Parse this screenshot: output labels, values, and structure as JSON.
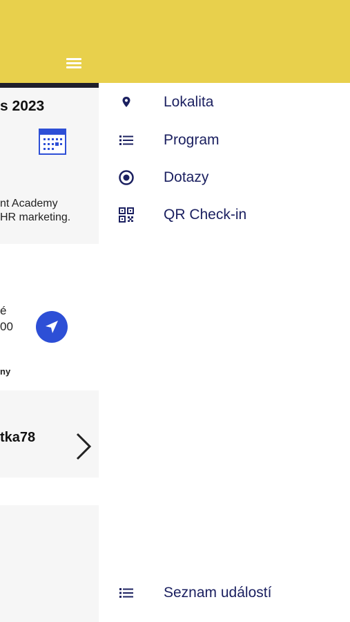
{
  "colors": {
    "accent_yellow": "#e8d04c",
    "menu_text": "#1b2060",
    "nav_blue": "#2d4fd6"
  },
  "underlay": {
    "title": "s 2023",
    "desc_line1": "nt Academy",
    "desc_line2": "HR marketing.",
    "time_line1": "é",
    "time_line2": "00",
    "note": "ny",
    "code": "tka78"
  },
  "drawer": {
    "items": [
      {
        "label": "Lokalita",
        "icon": "location-pin-icon"
      },
      {
        "label": "Program",
        "icon": "list-icon"
      },
      {
        "label": "Dotazy",
        "icon": "target-icon"
      },
      {
        "label": "QR Check-in",
        "icon": "qr-code-icon"
      }
    ],
    "footer_item": {
      "label": "Seznam událostí",
      "icon": "list-icon"
    }
  }
}
